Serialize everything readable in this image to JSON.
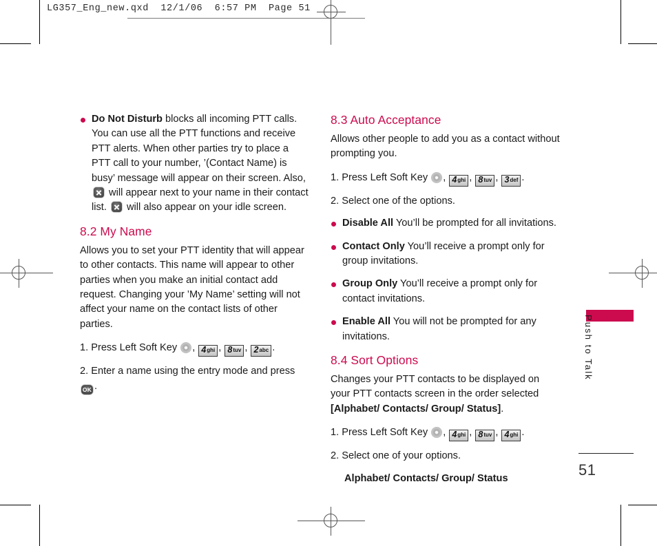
{
  "proof_header": "LG357_Eng_new.qxd  12/1/06  6:57 PM  Page 51",
  "colors": {
    "accent": "#cc0a4e",
    "text": "#1a1a1a"
  },
  "left_column": {
    "dnd_bullet": {
      "term": "Do Not Disturb",
      "text_part_1": " blocks all incoming PTT calls. You can use all the PTT functions and receive PTT alerts. When other parties try to place a PTT call to your number, ’(Contact Name) is busy’ message will appear on their screen. Also, ",
      "text_part_2": " will appear next to your name in their contact list. ",
      "text_part_3": " will also appear on your idle screen."
    },
    "section_8_2": {
      "heading": "8.2 My Name",
      "body": "Allows you to set your PTT identity that will appear to other contacts. This name will appear to other parties when you make an initial contact add request. Changing your ’My Name’ setting will not affect your name on the contact lists of other parties.",
      "step_1_prefix": "1. Press Left Soft Key ",
      "step_1_keys": [
        {
          "digit": "4",
          "letters": "ghi"
        },
        {
          "digit": "8",
          "letters": "tuv"
        },
        {
          "digit": "2",
          "letters": "abc"
        }
      ],
      "step_2_prefix": "2. Enter a name using the entry mode and press ",
      "step_2_key_label": "OK",
      "step_2_suffix": "."
    }
  },
  "right_column": {
    "section_8_3": {
      "heading": "8.3 Auto Acceptance",
      "body": "Allows other people to add you as a contact without prompting you.",
      "step_1_prefix": "1. Press Left Soft Key ",
      "step_1_keys": [
        {
          "digit": "4",
          "letters": "ghi"
        },
        {
          "digit": "8",
          "letters": "tuv"
        },
        {
          "digit": "3",
          "letters": "def"
        }
      ],
      "step_2": "2. Select one of the options.",
      "options": [
        {
          "term": "Disable All",
          "desc": " You’ll be prompted for all invitations."
        },
        {
          "term": "Contact Only",
          "desc": " You’ll receive a prompt only for group invitations."
        },
        {
          "term": "Group Only",
          "desc": " You’ll receive a prompt only for contact invitations."
        },
        {
          "term": "Enable All",
          "desc": " You will not be prompted for any invitations."
        }
      ]
    },
    "section_8_4": {
      "heading": "8.4 Sort Options",
      "body_normal": "Changes your PTT contacts to be displayed on your PTT contacts screen in the order selected ",
      "body_bold": "[Alphabet/ Contacts/ Group/ Status]",
      "body_tail": ".",
      "step_1_prefix": "1. Press Left Soft Key ",
      "step_1_keys": [
        {
          "digit": "4",
          "letters": "ghi"
        },
        {
          "digit": "8",
          "letters": "tuv"
        },
        {
          "digit": "4",
          "letters": "ghi"
        }
      ],
      "step_2": "2. Select one of your options.",
      "options_line": "Alphabet/ Contacts/ Group/ Status"
    }
  },
  "side_tab": {
    "label": "Push to Talk"
  },
  "folio": {
    "page_number": "51"
  }
}
